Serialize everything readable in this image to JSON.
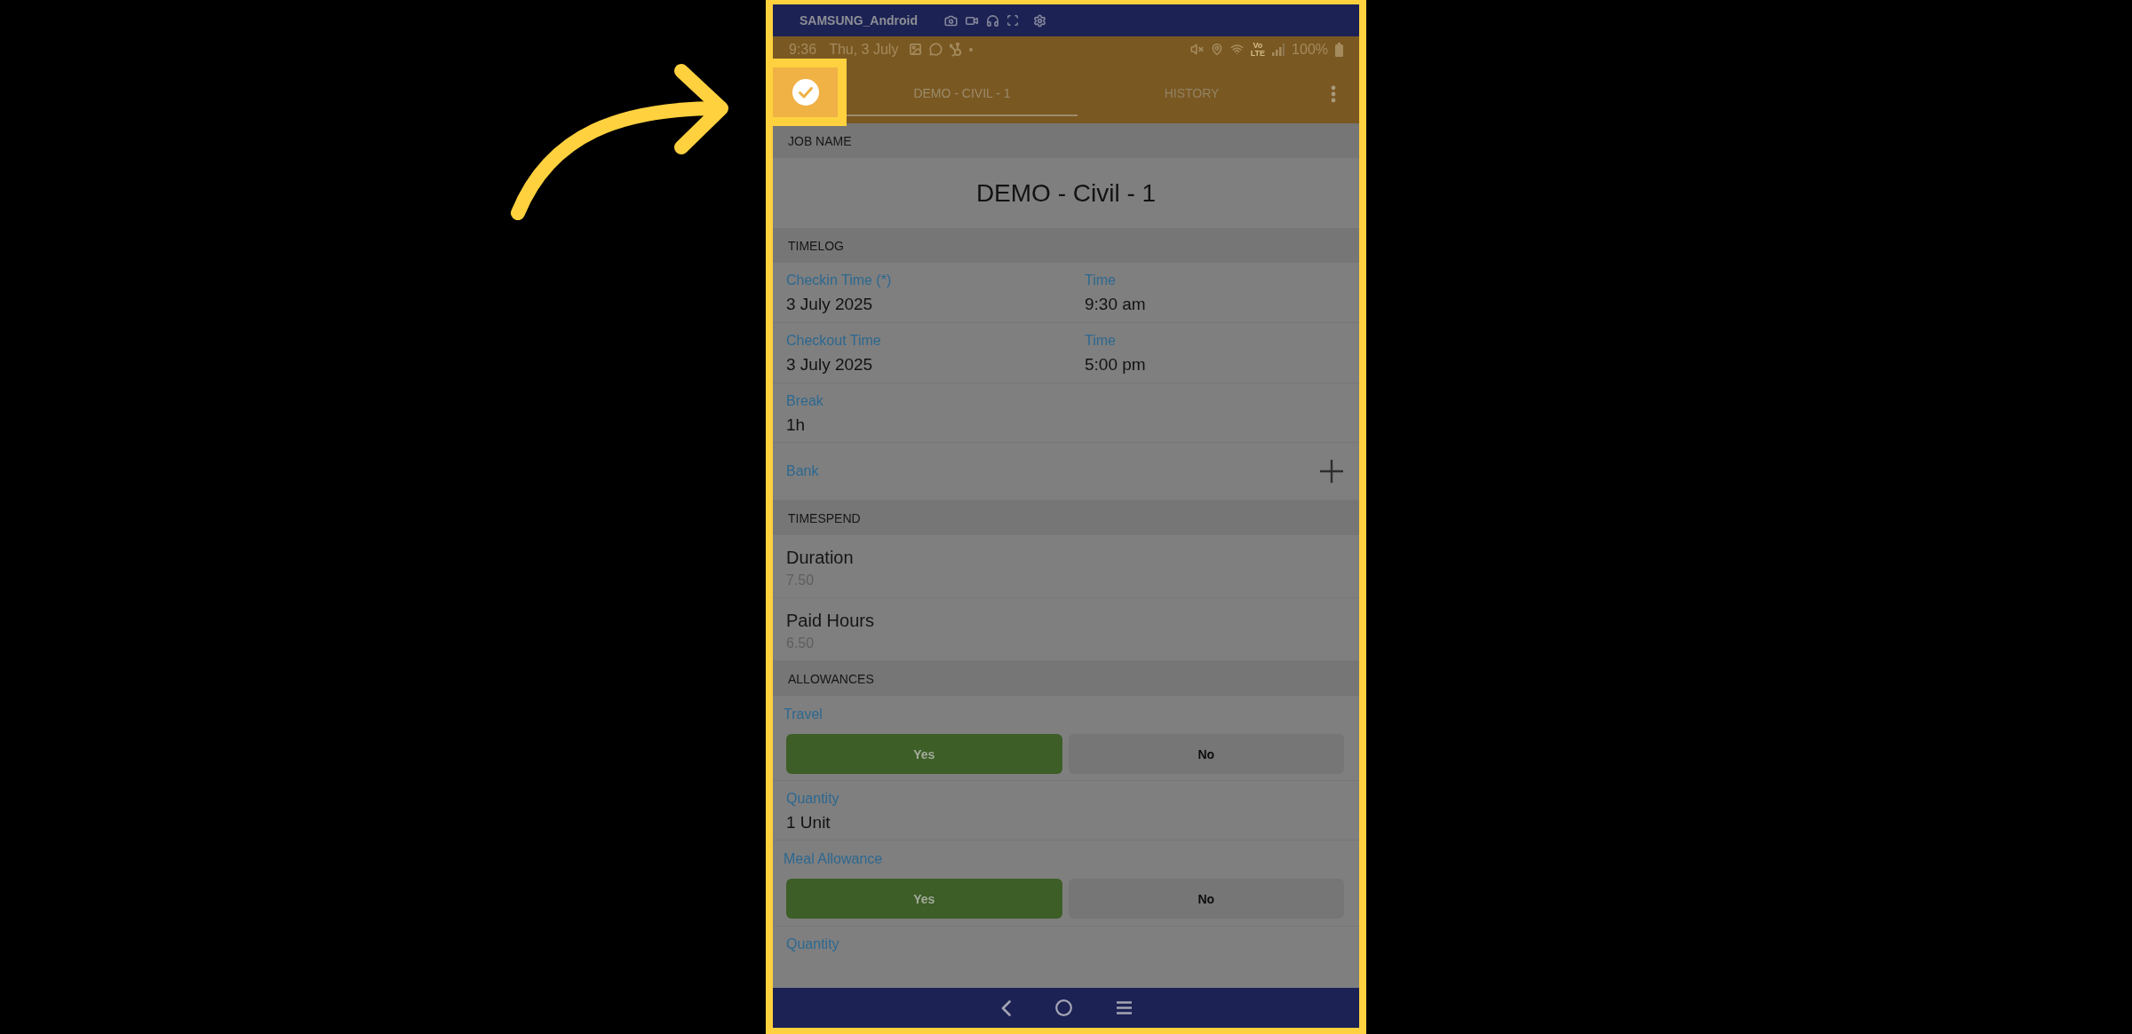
{
  "device": {
    "title": "SAMSUNG_Android"
  },
  "status_bar": {
    "time": "9:36",
    "date": "Thu, 3 July",
    "network": [
      "Vo",
      "LTE"
    ],
    "battery": "100%"
  },
  "app_bar": {
    "tabs": [
      {
        "label": "DEMO - CIVIL - 1",
        "selected": true
      },
      {
        "label": "HISTORY",
        "selected": false
      }
    ]
  },
  "sections": [
    {
      "title": "JOB NAME",
      "rows": [
        {
          "kind": "title",
          "value": "DEMO - Civil - 1"
        }
      ]
    },
    {
      "title": "TIMELOG",
      "rows": [
        {
          "kind": "pair",
          "fields": [
            {
              "label": "Checkin Time (*)",
              "value": "3 July 2025"
            },
            {
              "label": "Time",
              "value": "9:30 am"
            }
          ]
        },
        {
          "kind": "pair",
          "fields": [
            {
              "label": "Checkout Time",
              "value": "3 July 2025"
            },
            {
              "label": "Time",
              "value": "5:00 pm"
            }
          ]
        },
        {
          "kind": "field",
          "label": "Break",
          "value": "1h"
        },
        {
          "kind": "add",
          "label": "Bank"
        }
      ]
    },
    {
      "title": "TIMESPEND",
      "rows": [
        {
          "kind": "stat",
          "label": "Duration",
          "value": "7.50"
        },
        {
          "kind": "stat",
          "label": "Paid Hours",
          "value": "6.50"
        }
      ]
    },
    {
      "title": "ALLOWANCES",
      "rows": [
        {
          "kind": "toggle",
          "label": "Travel",
          "options": [
            {
              "label": "Yes",
              "selected": true
            },
            {
              "label": "No",
              "selected": false
            }
          ]
        },
        {
          "kind": "field",
          "label": "Quantity",
          "value": "1 Unit"
        },
        {
          "kind": "toggle",
          "label": "Meal Allowance",
          "options": [
            {
              "label": "Yes",
              "selected": true
            },
            {
              "label": "No",
              "selected": false
            }
          ]
        },
        {
          "kind": "field",
          "label": "Quantity"
        }
      ]
    }
  ]
}
